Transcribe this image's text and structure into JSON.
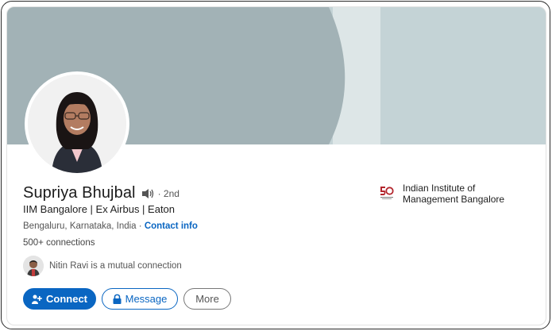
{
  "profile": {
    "name": "Supriya Bhujbal",
    "degree": "· 2nd",
    "headline": "IIM Bangalore | Ex Airbus | Eaton",
    "location": "Bengaluru, Karnataka, India ·",
    "contact_info": "Contact info",
    "connections": "500+ connections",
    "mutual_connection": "Nitin Ravi is a mutual connection"
  },
  "education": {
    "school": "Indian Institute of Management Bangalore",
    "logo_icon": "iimb-50-logo-icon"
  },
  "actions": {
    "connect_label": "Connect",
    "message_label": "Message",
    "more_label": "More"
  },
  "icons": {
    "speaker": "speaker-icon",
    "connect": "add-person-icon",
    "message": "lock-icon"
  },
  "colors": {
    "accent": "#0a66c2",
    "banner_light": "#c4d3d6",
    "banner_dark": "#a2b2b6",
    "banner_band": "#dde6e7"
  }
}
